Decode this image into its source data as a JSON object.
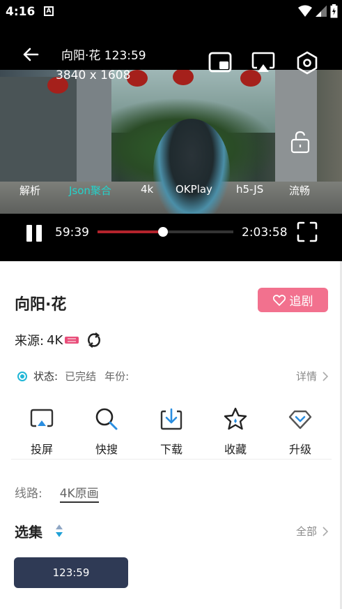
{
  "status_bar": {
    "time": "4:16",
    "notification_glyph": "A"
  },
  "player": {
    "title": "向阳·花 123:59",
    "resolution": "3840 x 1608",
    "sources": [
      {
        "label": "解析",
        "active": false
      },
      {
        "label": "Json聚合",
        "active": true
      },
      {
        "label": "4k",
        "active": false
      },
      {
        "label": "OKPlay",
        "active": false
      },
      {
        "label": "h5-JS",
        "active": false
      },
      {
        "label": "流畅",
        "active": false
      }
    ],
    "current_time": "59:39",
    "total_time": "2:03:58",
    "progress": 0.483,
    "accent_color": "#23d4cc",
    "progress_color": "#b3232c",
    "icons": [
      "back-arrow-icon",
      "pip-icon",
      "airplay-icon",
      "settings-hexagon-icon",
      "unlock-icon",
      "pause-icon",
      "fullscreen-icon"
    ]
  },
  "info": {
    "show_title": "向阳·花",
    "follow_label": "追剧",
    "follow_color": "#f2718e",
    "source_label": "来源:",
    "source_value": "4K",
    "status_label": "状态:",
    "status_value": "已完结",
    "year_label": "年份:",
    "detail_label": "详情",
    "actions": [
      {
        "label": "投屏",
        "icon": "cast-icon"
      },
      {
        "label": "快搜",
        "icon": "search-icon"
      },
      {
        "label": "下载",
        "icon": "download-icon"
      },
      {
        "label": "收藏",
        "icon": "star-icon"
      },
      {
        "label": "升级",
        "icon": "diamond-icon"
      }
    ],
    "route_label": "线路:",
    "route_value": "4K原画",
    "episodes_label": "选集",
    "all_label": "全部",
    "episodes": [
      "123:59"
    ],
    "episode_bg": "#2f3a55"
  }
}
